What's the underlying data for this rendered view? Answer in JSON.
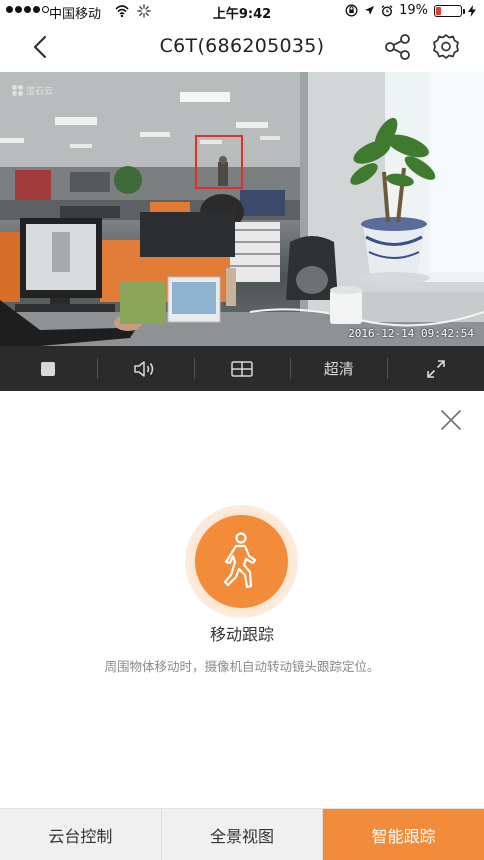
{
  "status_bar": {
    "carrier": "中国移动",
    "time": "上午9:42",
    "battery": "19%",
    "battery_level": 0.19
  },
  "nav": {
    "title": "C6T(686205035)"
  },
  "video": {
    "logo_text": "萤石云",
    "timestamp": "2016-12-14 09:42:54"
  },
  "controls": {
    "quality_label": "超清"
  },
  "panel": {
    "feature_title": "移动跟踪",
    "feature_desc": "周围物体移动时，摄像机自动转动镜头跟踪定位。"
  },
  "tabs": [
    {
      "label": "云台控制",
      "active": false
    },
    {
      "label": "全景视图",
      "active": false
    },
    {
      "label": "智能跟踪",
      "active": true
    }
  ],
  "colors": {
    "accent": "#f28b3a",
    "control_bar": "#2b2b2b",
    "track_box": "#e0302b"
  }
}
